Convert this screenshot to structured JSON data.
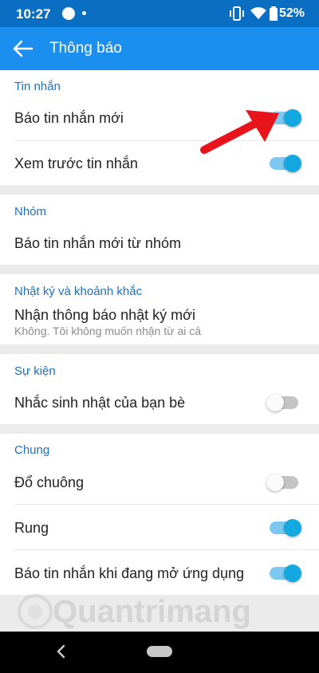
{
  "status_bar": {
    "time": "10:27",
    "app_icon": "zalo-icon",
    "battery_text": "52%"
  },
  "header": {
    "title": "Thông báo",
    "back_icon": "arrow-left-icon"
  },
  "sections": {
    "messages": {
      "title": "Tin nhắn",
      "items": [
        {
          "label": "Báo tin nhắn mới",
          "toggle": true
        },
        {
          "label": "Xem trước tin nhắn",
          "toggle": true
        }
      ]
    },
    "group": {
      "title": "Nhóm",
      "items": [
        {
          "label": "Báo tin nhắn mới từ nhóm"
        }
      ]
    },
    "diary": {
      "title": "Nhật ký và khoảnh khắc",
      "items": [
        {
          "label": "Nhận thông báo nhật ký mới",
          "sublabel": "Không. Tôi không muốn nhận từ ai cả"
        }
      ]
    },
    "events": {
      "title": "Sự kiện",
      "items": [
        {
          "label": "Nhắc sinh nhật của bạn bè",
          "toggle": false
        }
      ]
    },
    "general": {
      "title": "Chung",
      "items": [
        {
          "label": "Đổ chuông",
          "toggle": false
        },
        {
          "label": "Rung",
          "toggle": true
        },
        {
          "label": "Báo tin nhắn khi đang mở ứng dụng",
          "toggle": true
        }
      ]
    }
  },
  "watermark": {
    "text": "Quantrimang"
  },
  "colors": {
    "status_bar": "#0a6fc2",
    "app_bar": "#1a8ff0",
    "section_title": "#1c6fc2",
    "toggle_on_knob": "#13a8e0",
    "toggle_on_track": "#7cc8f0",
    "toggle_off_track": "#c4c4c4",
    "annotation_arrow": "#e8141c"
  }
}
